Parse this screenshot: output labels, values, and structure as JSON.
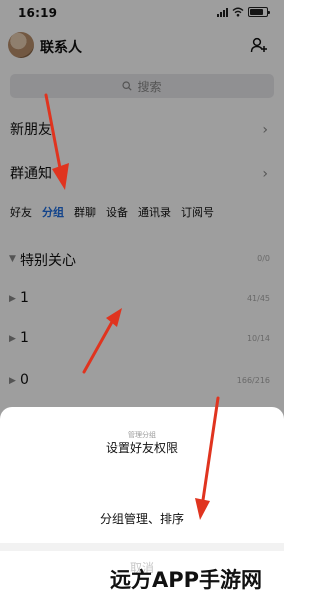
{
  "status_bar": {
    "time": "16:19"
  },
  "header": {
    "title": "联系人"
  },
  "search": {
    "placeholder": "搜索"
  },
  "rows": {
    "new_friend": "新朋友",
    "group_notice": "群通知"
  },
  "tabs": [
    {
      "label": "好友",
      "active": false
    },
    {
      "label": "分组",
      "active": true
    },
    {
      "label": "群聊",
      "active": false
    },
    {
      "label": "设备",
      "active": false
    },
    {
      "label": "通讯录",
      "active": false
    },
    {
      "label": "订阅号",
      "active": false
    }
  ],
  "groups": [
    {
      "name": "特别关心",
      "count": "0/0"
    },
    {
      "name": "1",
      "count": "41/45"
    },
    {
      "name": "1",
      "count": "10/14"
    },
    {
      "name": "0",
      "count": "166/216"
    }
  ],
  "action_sheet": {
    "title": "管理分组 ",
    "items": [
      "设置好友权限",
      "分组管理、排序"
    ],
    "cancel": "取消"
  },
  "watermark": "远方APP手游网",
  "colors": {
    "accent": "#1f6fe0",
    "arrow": "#e0341f"
  },
  "icons": [
    "search-icon",
    "add-contact-icon",
    "chevron-right-icon",
    "signal-icon",
    "wifi-icon",
    "battery-icon"
  ]
}
